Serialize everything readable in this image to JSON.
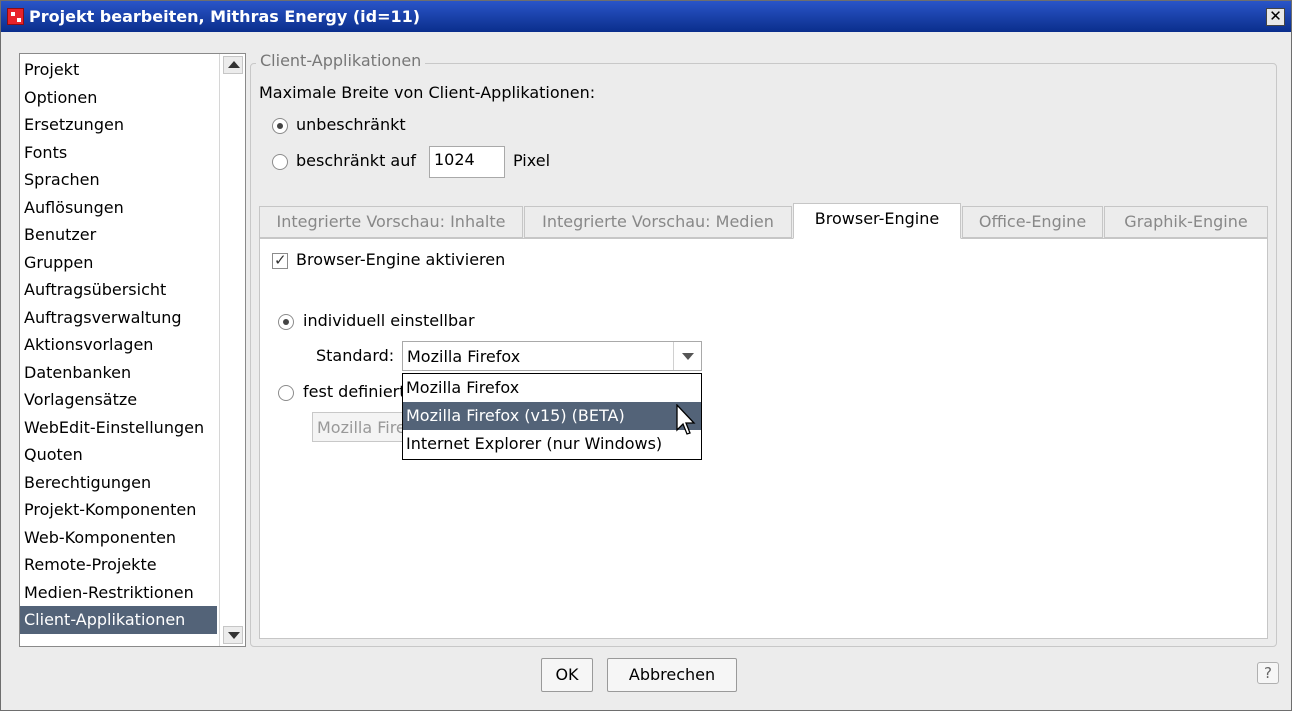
{
  "window": {
    "title": "Projekt bearbeiten, Mithras Energy (id=11)",
    "close_glyph": "✕"
  },
  "sidebar": {
    "items": [
      {
        "label": "Projekt"
      },
      {
        "label": "Optionen"
      },
      {
        "label": "Ersetzungen"
      },
      {
        "label": "Fonts"
      },
      {
        "label": "Sprachen"
      },
      {
        "label": "Auflösungen"
      },
      {
        "label": "Benutzer"
      },
      {
        "label": "Gruppen"
      },
      {
        "label": "Auftragsübersicht"
      },
      {
        "label": "Auftragsverwaltung"
      },
      {
        "label": "Aktionsvorlagen"
      },
      {
        "label": "Datenbanken"
      },
      {
        "label": "Vorlagensätze"
      },
      {
        "label": "WebEdit-Einstellungen"
      },
      {
        "label": "Quoten"
      },
      {
        "label": "Berechtigungen"
      },
      {
        "label": "Projekt-Komponenten"
      },
      {
        "label": "Web-Komponenten"
      },
      {
        "label": "Remote-Projekte"
      },
      {
        "label": "Medien-Restriktionen"
      },
      {
        "label": "Client-Applikationen"
      }
    ],
    "selected": "Client-Applikationen"
  },
  "panel": {
    "group_title": "Client-Applikationen",
    "max_width_label": "Maximale Breite von Client-Applikationen:",
    "radio_unlimited": "unbeschränkt",
    "radio_limited": "beschränkt auf",
    "limit_value": "1024",
    "limit_unit": "Pixel"
  },
  "tabs": [
    {
      "label": "Integrierte Vorschau: Inhalte"
    },
    {
      "label": "Integrierte Vorschau: Medien"
    },
    {
      "label": "Browser-Engine"
    },
    {
      "label": "Office-Engine"
    },
    {
      "label": "Graphik-Engine"
    }
  ],
  "active_tab": "Browser-Engine",
  "browser_engine": {
    "activate_label": "Browser-Engine aktivieren",
    "activate_checked": true,
    "individual_label": "individuell einstellbar",
    "standard_label": "Standard:",
    "standard_value": "Mozilla Firefox",
    "fixed_label": "fest definiert",
    "fixed_value": "Mozilla Firefox",
    "dropdown_options": [
      {
        "label": "Mozilla Firefox"
      },
      {
        "label": "Mozilla Firefox (v15) (BETA)"
      },
      {
        "label": "Internet Explorer (nur Windows)"
      }
    ],
    "highlighted_option": "Mozilla Firefox (v15) (BETA)"
  },
  "buttons": {
    "ok": "OK",
    "cancel": "Abbrechen",
    "help": "?"
  },
  "colors": {
    "selection": "#536378",
    "titlebar": "#1f47b5"
  }
}
